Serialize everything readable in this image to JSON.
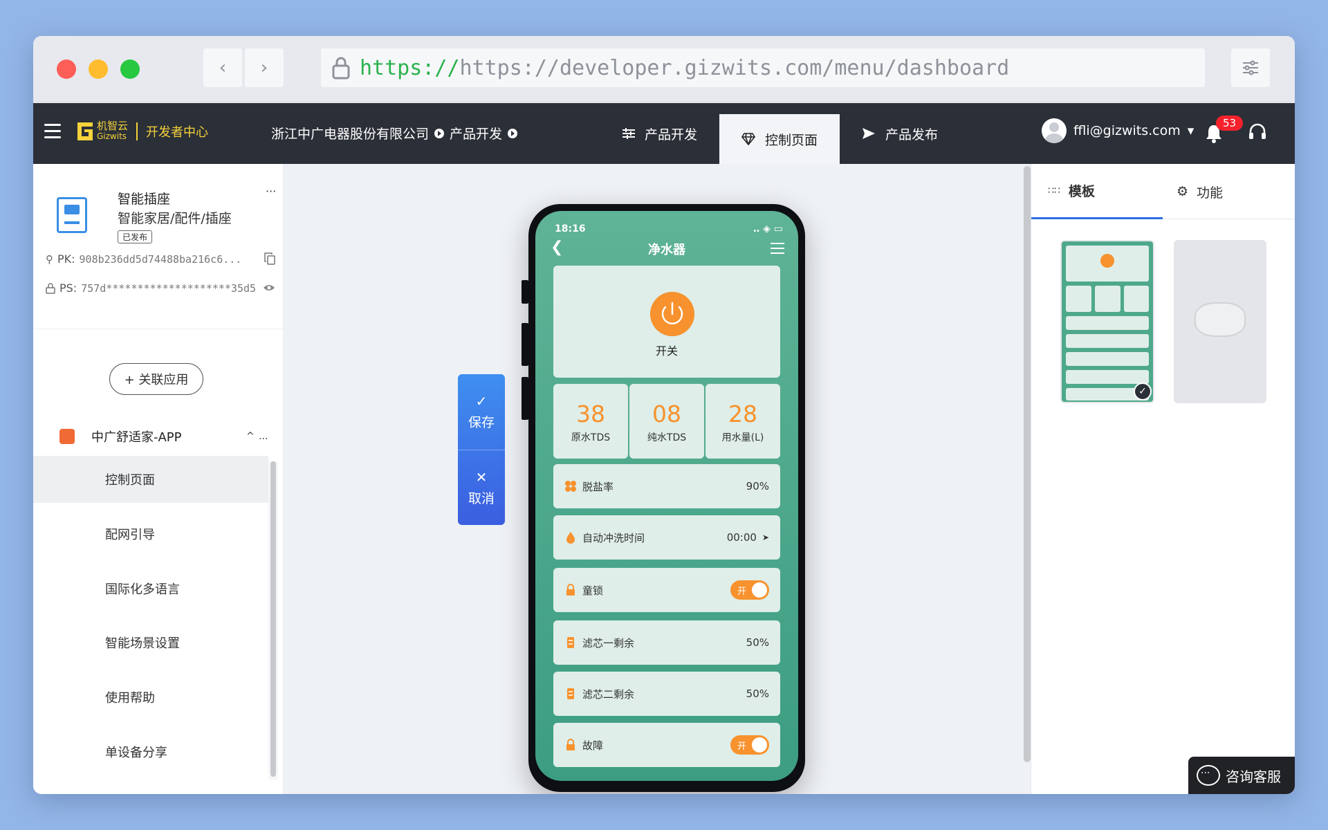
{
  "browser": {
    "url_scheme": "https://",
    "url_rest": "https://developer.gizwits.com/menu/dashboard"
  },
  "header": {
    "brand_cn": "机智云",
    "brand_en": "Gizwits",
    "dev_center": "开发者中心",
    "company": "浙江中广电器股份有限公司",
    "crumb_product": "产品开发",
    "tabs": [
      {
        "label": "产品开发",
        "icon": "sliders-icon"
      },
      {
        "label": "控制页面",
        "icon": "diamond-icon"
      },
      {
        "label": "产品发布",
        "icon": "send-icon"
      }
    ],
    "user_email": "ffli@gizwits.com",
    "notification_count": "53"
  },
  "sidebar": {
    "product_name": "智能插座",
    "product_category": "智能家居/配件/插座",
    "product_status": "已发布",
    "more": "···",
    "pk_label": "PK:",
    "pk_value": "908b236dd5d74488ba216c6...",
    "ps_label": "PS:",
    "ps_value": "757d********************35d5",
    "link_app_button": "+ 关联应用",
    "app_name": "中广舒适家-APP",
    "app_more": "...",
    "menu": [
      "控制页面",
      "配网引导",
      "国际化多语言",
      "智能场景设置",
      "使用帮助",
      "单设备分享"
    ]
  },
  "actions": {
    "save": "保存",
    "cancel": "取消"
  },
  "phone": {
    "time": "18:16",
    "title": "净水器",
    "power_label": "开关",
    "stats": [
      {
        "value": "38",
        "label": "原水TDS"
      },
      {
        "value": "08",
        "label": "纯水TDS"
      },
      {
        "value": "28",
        "label": "用水量(L)"
      }
    ],
    "rows": [
      {
        "label": "脱盐率",
        "value": "90%"
      },
      {
        "label": "自动冲洗时间",
        "value": "00:00"
      },
      {
        "label": "童锁",
        "toggle": "开"
      },
      {
        "label": "滤芯一剩余",
        "value": "50%"
      },
      {
        "label": "滤芯二剩余",
        "value": "50%"
      },
      {
        "label": "故障",
        "toggle": "开"
      }
    ]
  },
  "right_panel": {
    "tab_template": "模板",
    "tab_function": "功能"
  },
  "support": {
    "consult": "咨询客服"
  },
  "colors": {
    "accent_orange": "#f7922e",
    "phone_green": "#4ea88c",
    "primary_blue": "#3b6fe6",
    "header_dark": "#2b2f37",
    "brand_yellow": "#f5d33b"
  }
}
